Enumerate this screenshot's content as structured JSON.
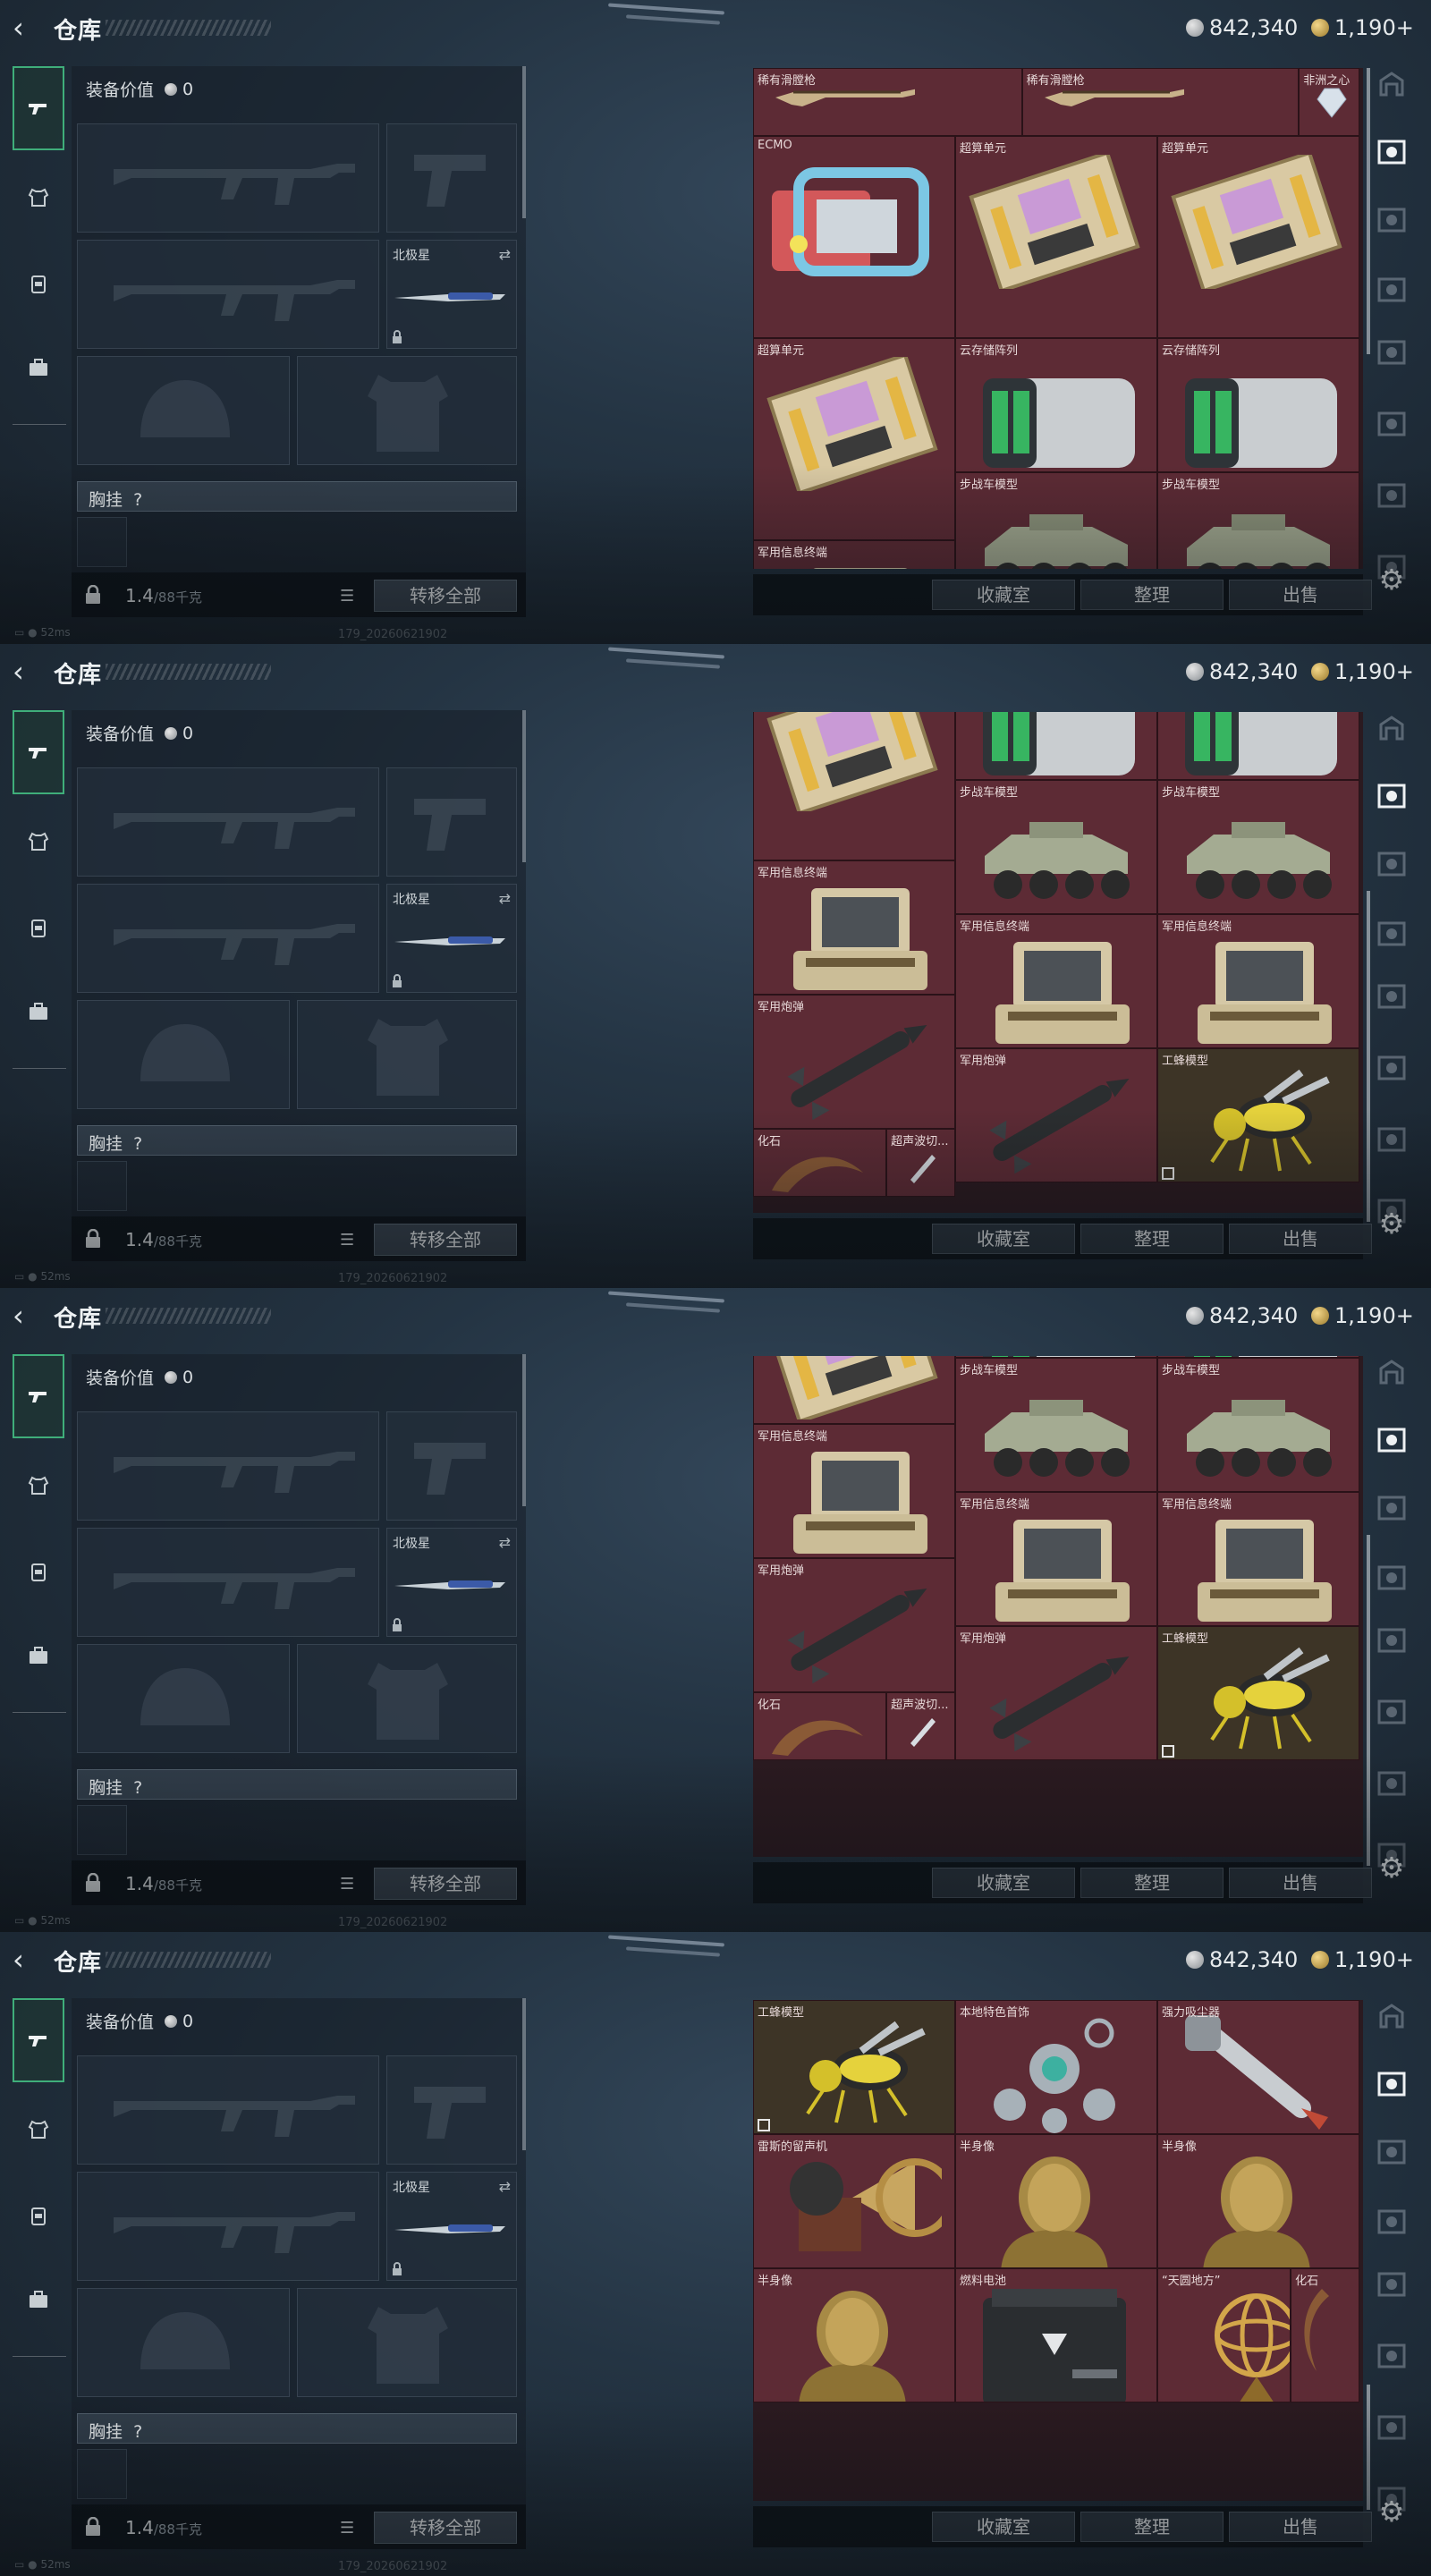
{
  "header": {
    "title": "仓库",
    "silver": "842,340",
    "gold": "1,190",
    "gold_plus": "+"
  },
  "nav": {
    "items": [
      "weapons-tab",
      "armor-tab",
      "backpack-tab",
      "case-tab"
    ]
  },
  "equipment": {
    "value_label": "装备价值",
    "value": "0",
    "secondary_label": "北极星",
    "chest_label": "胸挂",
    "chest_hint": "?",
    "weight": "1.4",
    "weight_max": "/88千克",
    "transfer_label": "转移全部"
  },
  "storage": {
    "btn_collection": "收藏室",
    "btn_sort": "整理",
    "btn_sell": "出售"
  },
  "items": {
    "rare_rifle": "稀有滑膛枪",
    "heart": "非洲之心",
    "ecmo": "ECMO",
    "compute_unit": "超算单元",
    "cloud_array": "云存储阵列",
    "ifv_model": "步战车模型",
    "mil_terminal": "军用信息终端",
    "mil_shell": "军用炮弹",
    "fossil": "化石",
    "ultrasonic": "超声波切...",
    "bee_model": "工蜂模型",
    "jewelry": "本地特色首饰",
    "vacuum": "强力吸尘器",
    "gramophone": "雷斯的留声机",
    "bust": "半身像",
    "fuel_cell": "燃料电池",
    "armillary": "“天圆地方”"
  },
  "footer": {
    "ping": "52ms",
    "build": "179_20260621902"
  },
  "colors": {
    "cell_red": "#5d2b35",
    "cell_gold": "#3d3426",
    "accent_green": "#3fae7a"
  }
}
